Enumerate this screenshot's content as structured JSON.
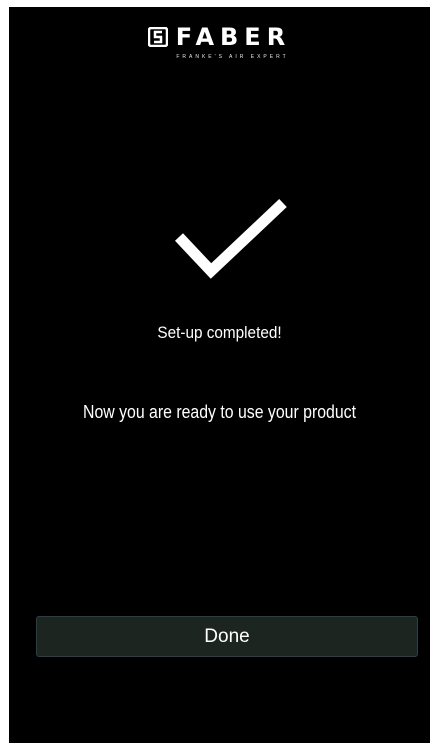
{
  "brand": {
    "name": "FABER",
    "tagline": "FRANKE'S AIR EXPERT",
    "logo_icon": "faber-logo-icon"
  },
  "status": {
    "icon": "checkmark-icon",
    "headline": "Set-up completed!",
    "message": "Now you are ready to use your product"
  },
  "actions": {
    "done_label": "Done"
  },
  "colors": {
    "background": "#000000",
    "text": "#ffffff",
    "button_bg": "#1c2520",
    "button_border": "#2c3e4a"
  }
}
